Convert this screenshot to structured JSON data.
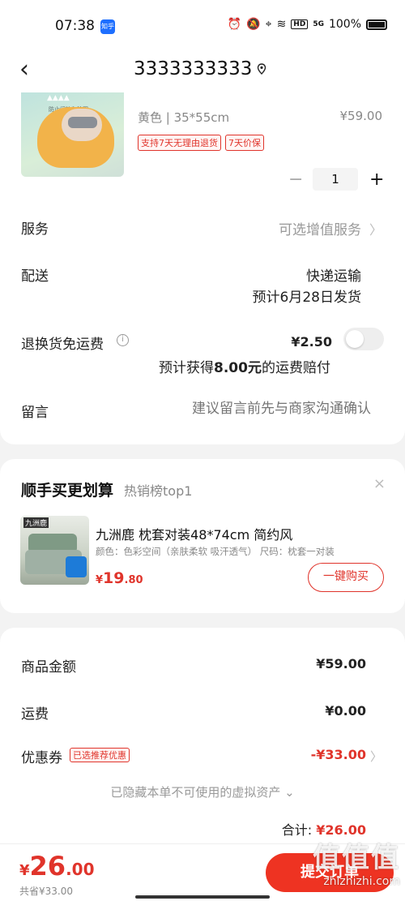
{
  "status_bar": {
    "time": "07:38",
    "app_badge": "知乎",
    "network": "5G",
    "hd": "HD",
    "battery": "100%"
  },
  "header": {
    "back_icon": "chevron-left-icon",
    "title": "3333333333",
    "location_icon": "location-pin-icon"
  },
  "product": {
    "image_caption_top": "防止闷热和脸圈",
    "spec": "黄色 | 35*55cm",
    "price": "¥59.00",
    "tags": [
      "支持7天无理由退货",
      "7天价保"
    ],
    "quantity": "1",
    "minus": "−",
    "plus": "+"
  },
  "order_options": {
    "service_label": "服务",
    "service_value": "可选增值服务",
    "delivery_label": "配送",
    "delivery_value": "快递运输",
    "delivery_date": "预计6月28日发货",
    "return_label": "退换货免运费",
    "return_price": "¥2.50",
    "return_note_prefix": "预计获得",
    "return_note_amount": "8.00元",
    "return_note_suffix": "的运费赔付",
    "return_toggle_on": false,
    "message_label": "留言",
    "message_placeholder": "建议留言前先与商家沟通确认"
  },
  "recommend": {
    "title": "顺手买更划算",
    "subtitle": "热销榜top1",
    "close": "×",
    "image_brand": "九洲鹿",
    "name": "九洲鹿 枕套对装48*74cm 简约风",
    "attrs": "颜色：色彩空间（亲肤柔软 吸汗透气）   尺码：枕套一对装",
    "price_symbol": "¥",
    "price_int": "19",
    "price_dec": ".80",
    "buy_label": "一键购买"
  },
  "summary": {
    "goods_label": "商品金额",
    "goods_value": "¥59.00",
    "shipping_label": "运费",
    "shipping_value": "¥0.00",
    "coupon_label": "优惠券",
    "coupon_tag": "已选推荐优惠",
    "coupon_value": "-¥33.00",
    "hidden_note": "已隐藏本单不可使用的虚拟资产 ⌄",
    "total_label": "合计:",
    "total_value": "¥26.00"
  },
  "bottom_bar": {
    "pay_symbol": "¥",
    "pay_int": "26",
    "pay_dec": ".00",
    "saved": "共省¥33.00",
    "submit_label": "提交订单"
  },
  "watermark": {
    "big": "值值值",
    "small": "zhizhizhi.com"
  },
  "colors": {
    "accent": "#e0342b",
    "submit": "#ee3322",
    "muted": "#999999"
  }
}
